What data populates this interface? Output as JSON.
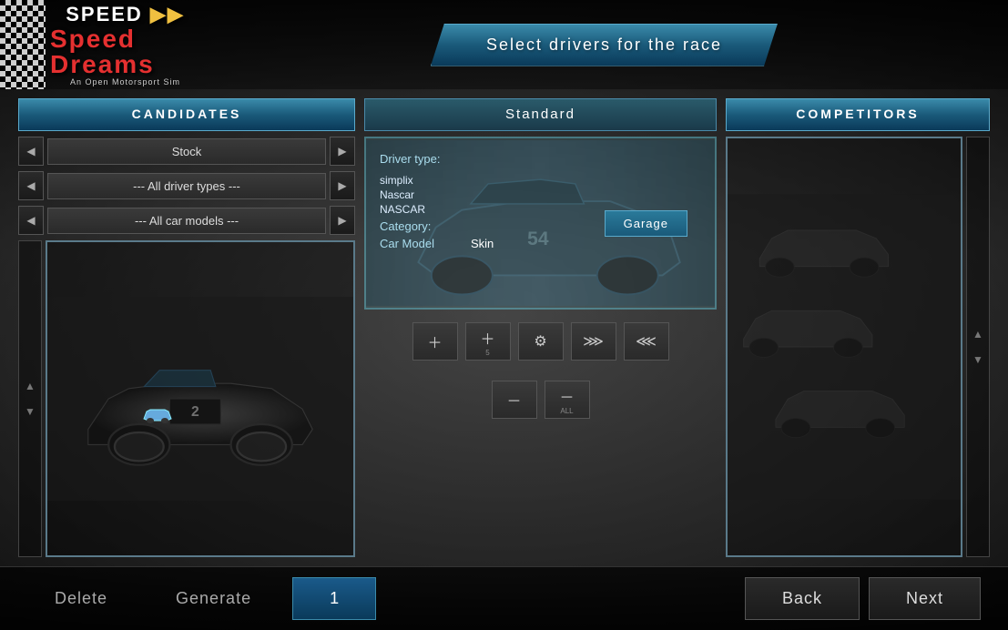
{
  "app": {
    "title": "Speed Dreams",
    "subtitle": "An Open Motorsport Sim"
  },
  "header": {
    "title": "Select drivers for the race"
  },
  "candidates": {
    "section_label": "CANDIDATES",
    "filter_stock": "Stock",
    "filter_driver_types": "--- All driver types ---",
    "filter_car_models": "--- All car models ---"
  },
  "middle": {
    "standard_label": "Standard",
    "driver_type_label": "Driver type:",
    "driver_type_value": "",
    "category_label": "Category:",
    "category_value": "",
    "car_model_label": "Car Model:",
    "car_model_value": "",
    "skin_label": "Skin",
    "garage_button": "Garage",
    "driver_names": [
      {
        "name": "simplix"
      },
      {
        "name": "Nascar"
      },
      {
        "name": "NASCAR"
      }
    ]
  },
  "action_buttons": {
    "add_one": "+",
    "add_all": "+",
    "add_all_label": "5",
    "remove_one": "−",
    "remove_all": "−",
    "remove_all_label": "ALL",
    "settings": "⚙",
    "move_up": "≫",
    "move_down": "≪"
  },
  "competitors": {
    "section_label": "COMPETITORS"
  },
  "bottom": {
    "delete_label": "Delete",
    "generate_label": "Generate",
    "count": "1",
    "back_label": "Back",
    "next_label": "Next"
  }
}
